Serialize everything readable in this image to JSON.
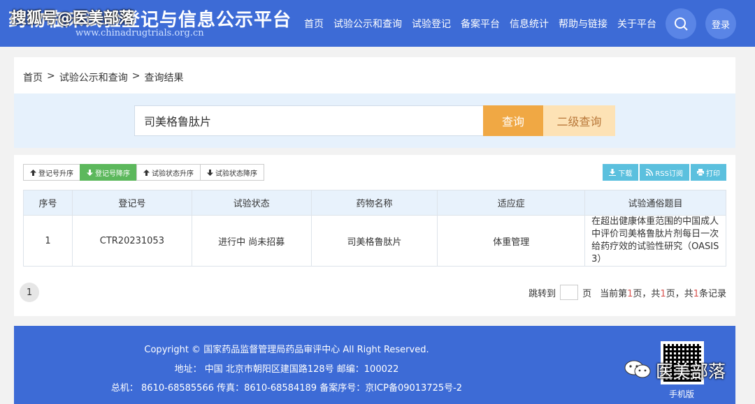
{
  "header": {
    "title": "药物临床试验登记与信息公示平台",
    "url": "www.chinadrugtrials.org.cn",
    "watermark": "搜狐号@医美部落",
    "nav": [
      "首页",
      "试验公示和查询",
      "试验登记",
      "备案平台",
      "信息统计",
      "帮助与链接",
      "关于平台"
    ],
    "login_label": "登录",
    "search_icon": "search-icon"
  },
  "breadcrumb": [
    "首页",
    ">",
    "试验公示和查询",
    ">",
    "查询结果"
  ],
  "search": {
    "value": "司美格鲁肽片",
    "query_label": "查询",
    "advanced_label": "二级查询"
  },
  "sort_buttons": [
    {
      "label": "登记号升序",
      "icon": "arrow-up-icon",
      "active": false
    },
    {
      "label": "登记号降序",
      "icon": "arrow-down-icon",
      "active": true
    },
    {
      "label": "试验状态升序",
      "icon": "arrow-up-icon",
      "active": false
    },
    {
      "label": "试验状态降序",
      "icon": "arrow-down-icon",
      "active": false
    }
  ],
  "tool_buttons": [
    {
      "label": "下载",
      "icon": "download-icon"
    },
    {
      "label": "RSS订阅",
      "icon": "rss-icon"
    },
    {
      "label": "打印",
      "icon": "print-icon"
    }
  ],
  "table": {
    "columns": [
      "序号",
      "登记号",
      "试验状态",
      "药物名称",
      "适应症",
      "试验通俗题目"
    ],
    "rows": [
      [
        "1",
        "CTR20231053",
        "进行中 尚未招募",
        "司美格鲁肽片",
        "体重管理",
        "在超出健康体重范围的中国成人中评价司美格鲁肽片剂每日一次给药疗效的试验性研究（OASIS 3）"
      ]
    ]
  },
  "pager": {
    "current_page": "1",
    "jump_label": "跳转到",
    "page_unit": "页",
    "current_prefix": "当前第",
    "current_value": "1",
    "total_prefix": "页，共",
    "total_pages": "1",
    "records_prefix": "页，共",
    "records": "1",
    "records_suffix": "条记录"
  },
  "footer": {
    "copyright": "Copyright © 国家药品监督管理局药品审评中心 All Right Reserved.",
    "address": "地址： 中国 北京市朝阳区建国路128号 邮编：100022",
    "contact": "总机： 8610-68585566 传真：8610-68584189 备案序号：京ICP备09013725号-2",
    "wechat_label": "医美部落",
    "mobile_label": "手机版"
  },
  "colors": {
    "brand_blue": "#3d6bd6",
    "query_orange": "#f0a844",
    "sort_active_green": "#5cb85c",
    "tool_cyan": "#5bc0de",
    "highlight_red": "#d9534f"
  }
}
